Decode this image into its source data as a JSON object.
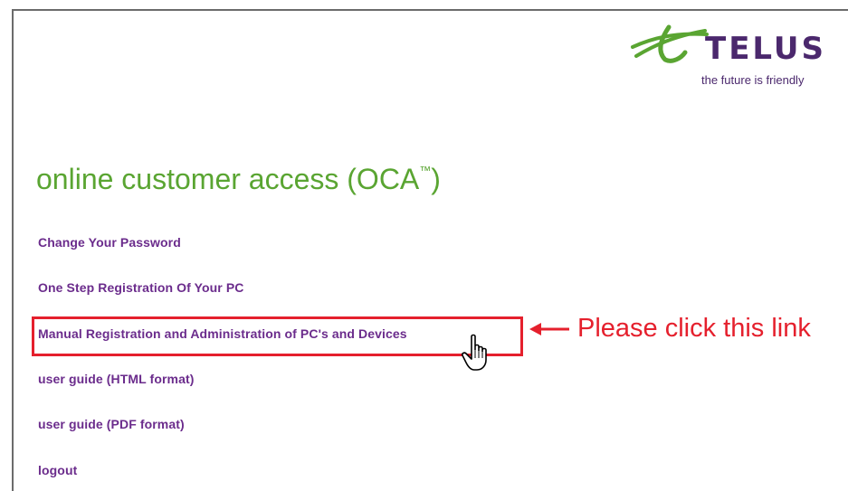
{
  "brand": {
    "name": "TELUS",
    "tagline": "the future is friendly",
    "brand_color": "#4b286d",
    "accent_color": "#5aa532"
  },
  "page": {
    "title": "online customer access (OCA",
    "title_mark": "™",
    "title_end": ")"
  },
  "links": [
    {
      "label": "Change Your Password"
    },
    {
      "label": "One Step Registration Of Your PC"
    },
    {
      "label": "Manual Registration and Administration of PC's and Devices"
    },
    {
      "label": "user guide (HTML format)"
    },
    {
      "label": "user guide (PDF format)"
    },
    {
      "label": "logout"
    }
  ],
  "annotation": {
    "text": "Please click this link",
    "color": "#e5202d"
  }
}
